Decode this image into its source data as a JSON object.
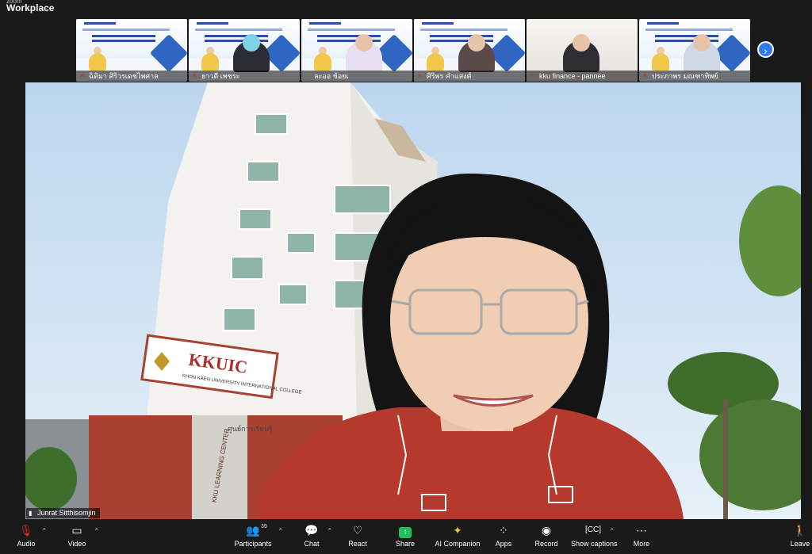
{
  "app": {
    "title_small": "zoom",
    "title": "Workplace"
  },
  "gallery": {
    "participants": [
      {
        "name": "ฉิติมา ศิริวรเดชไพศาล",
        "muted": true,
        "type": "slide"
      },
      {
        "name": "ยาวดี เพชระ",
        "muted": true,
        "type": "slide-cam"
      },
      {
        "name": "ละออ ช้อยเ",
        "muted": false,
        "type": "slide-cam"
      },
      {
        "name": "ศิริพร คำแสงศ์",
        "muted": true,
        "type": "slide-cam"
      },
      {
        "name": "kku finance - pannee",
        "muted": true,
        "type": "plain"
      },
      {
        "name": "ประภาพร มณฑาทิพย์",
        "muted": true,
        "type": "slide-cam"
      }
    ],
    "next_icon": "chevron-right-icon"
  },
  "speaker": {
    "name": "Junrat Sitthisomjin",
    "sign_text": "KKUIC",
    "sign_subtext": "KHON KAEN UNIVERSITY INTERNATIONAL COLLEGE",
    "side_sign": "KKU LEARNING CENTER",
    "thai_sign": "ศูนย์การเรียนรู้"
  },
  "toolbar": {
    "audio": "Audio",
    "video": "Video",
    "participants": "Participants",
    "participants_count": "39",
    "chat": "Chat",
    "react": "React",
    "share": "Share",
    "ai_companion": "AI Companion",
    "apps": "Apps",
    "record": "Record",
    "captions": "Show captions",
    "more": "More",
    "leave": "Leave"
  },
  "colors": {
    "accent": "#2f7bf5",
    "share": "#1fbf5b",
    "leave": "#e02828",
    "shirt": "#b5392c"
  }
}
